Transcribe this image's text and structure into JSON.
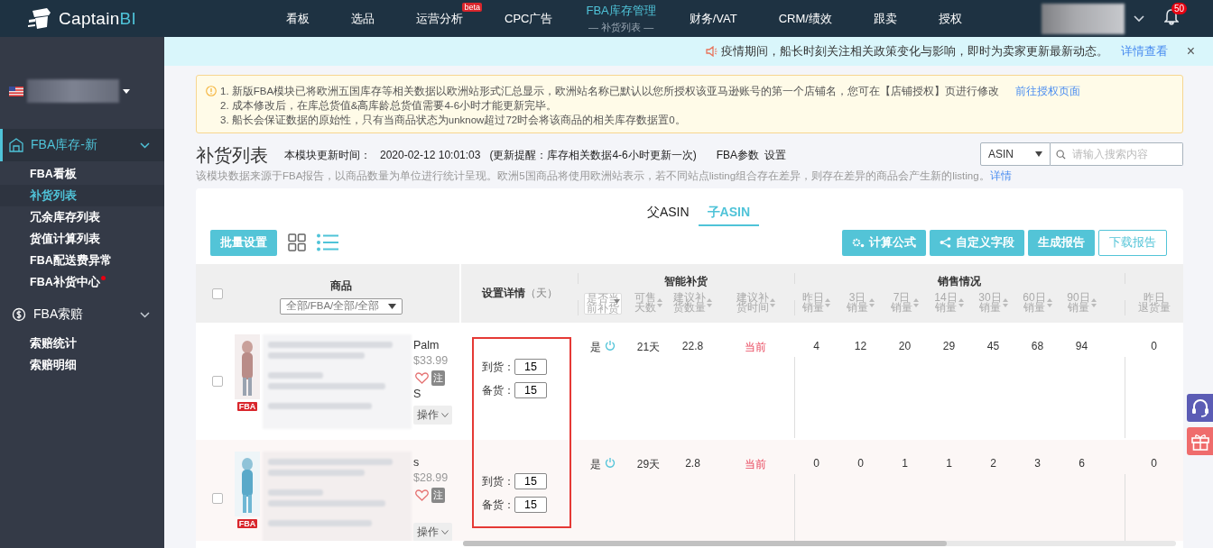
{
  "logo": {
    "text": "Captain",
    "accent": "BI"
  },
  "nav": [
    {
      "label": "看板",
      "selected": false
    },
    {
      "label": "选品",
      "selected": false
    },
    {
      "label": "运营分析",
      "selected": false,
      "badge": "beta"
    },
    {
      "label": "CPC广告",
      "selected": false
    },
    {
      "label": "FBA库存管理",
      "selected": true,
      "sublabel": "— 补货列表 —"
    },
    {
      "label": "财务/VAT",
      "selected": false
    },
    {
      "label": "CRM/绩效",
      "selected": false
    },
    {
      "label": "跟卖",
      "selected": false
    },
    {
      "label": "授权",
      "selected": false
    }
  ],
  "notifications": {
    "count": "50"
  },
  "sidebar": {
    "groups": [
      {
        "label": "FBA库存-新",
        "selected": true,
        "expanded": true,
        "children": [
          {
            "label": "FBA看板",
            "selected": false,
            "dot": false
          },
          {
            "label": "补货列表",
            "selected": true,
            "dot": false
          },
          {
            "label": "冗余库存列表",
            "selected": false,
            "dot": false
          },
          {
            "label": "货值计算列表",
            "selected": false,
            "dot": false
          },
          {
            "label": "FBA配送费异常",
            "selected": false,
            "dot": false
          },
          {
            "label": "FBA补货中心",
            "selected": false,
            "dot": true
          }
        ]
      },
      {
        "label": "FBA索赔",
        "selected": false,
        "expanded": true,
        "children": [
          {
            "label": "索赔统计",
            "selected": false,
            "dot": false
          },
          {
            "label": "索赔明细",
            "selected": false,
            "dot": false
          }
        ]
      }
    ]
  },
  "notice": {
    "text": "疫情期间，船长时刻关注相关政策变化与影响，即时为卖家更新最新动态。",
    "link": "详情查看",
    "close": "×"
  },
  "warning": {
    "lines": [
      "1. 新版FBA模块已将欧洲五国库存等相关数据以欧洲站形式汇总显示，欧洲站名称已默认以您所授权该亚马逊账号的第一个店铺名，您可在【店铺授权】页进行修改",
      "2. 成本修改后，在库总货值&高库龄总货值需要4-6小时才能更新完毕。",
      "3. 船长会保证数据的原始性，只有当商品状态为unknow超过72时会将该商品的相关库存数据置0。"
    ],
    "link": "前往授权页面"
  },
  "page": {
    "title": "补货列表",
    "update_label": "本模块更新时间：",
    "update_time": "2020-02-12 10:01:03",
    "update_note": "(更新提醒：库存相关数据4-6小时更新一次)",
    "params_label": "FBA参数",
    "params_link": "设置",
    "description": "该模块数据来源于FBA报告，以商品数量为单位进行统计呈现。欧洲5国商品将使用欧洲站表示，若不同站点listing组合存在差异，则存在差异的商品会产生新的listing。",
    "description_link": "详情"
  },
  "search": {
    "field": "ASIN",
    "placeholder": "请输入搜索内容"
  },
  "tabs": [
    {
      "label": "父ASIN",
      "selected": false
    },
    {
      "label": "子ASIN",
      "selected": true
    }
  ],
  "toolbar": {
    "batch": "批量设置",
    "views": [
      {
        "kind": "grid",
        "selected": false
      },
      {
        "kind": "list",
        "selected": true
      }
    ],
    "buttons": [
      {
        "label": "计算公式",
        "kind": "primary"
      },
      {
        "label": "自定义字段",
        "kind": "primary"
      },
      {
        "label": "生成报告",
        "kind": "primary"
      },
      {
        "label": "下载报告",
        "kind": "outline"
      }
    ]
  },
  "table": {
    "select_all_checked": false,
    "product": "商品",
    "product_filter": "全部/FBA/全部/全部",
    "settings": "设置详情",
    "settings_unit": "（天）",
    "smart_group": "智能补货",
    "smart_filter": [
      "是否当",
      "前补货"
    ],
    "smart_columns": [
      [
        "可售",
        "天数"
      ],
      [
        "建议补",
        "货数量"
      ],
      [
        "建议补",
        "货时间"
      ]
    ],
    "sales_group": "销售情况",
    "sales_columns": [
      [
        "昨日",
        "销量"
      ],
      [
        "3日",
        "销量"
      ],
      [
        "7日",
        "销量"
      ],
      [
        "14日",
        "销量"
      ],
      [
        "30日",
        "销量"
      ],
      [
        "60日",
        "销量"
      ],
      [
        "90日",
        "销量"
      ]
    ],
    "returns_column": [
      "昨日",
      "退货量"
    ],
    "rows": [
      {
        "checked": false,
        "title_tail": "Palm",
        "price": "$33.99",
        "variant_tail": "S",
        "note": "注",
        "favorite": false,
        "tag": "FBA",
        "action": "操作",
        "settings": [
          {
            "label": "到货：",
            "value": "15"
          },
          {
            "label": "备货：",
            "value": "15"
          }
        ],
        "replenish": "是",
        "days": "21天",
        "qty": "22.8",
        "time": "当前",
        "sales": [
          "4",
          "12",
          "20",
          "29",
          "45",
          "68",
          "94"
        ],
        "returns": "0"
      },
      {
        "checked": false,
        "title_tail": "s",
        "price": "$28.99",
        "note": "注",
        "favorite": false,
        "tag": "FBA",
        "action": "操作",
        "settings": [
          {
            "label": "到货：",
            "value": "15"
          },
          {
            "label": "备货：",
            "value": "15"
          }
        ],
        "replenish": "是",
        "days": "29天",
        "qty": "2.8",
        "time": "当前",
        "sales": [
          "0",
          "0",
          "1",
          "1",
          "2",
          "3",
          "6"
        ],
        "returns": "0"
      }
    ]
  }
}
